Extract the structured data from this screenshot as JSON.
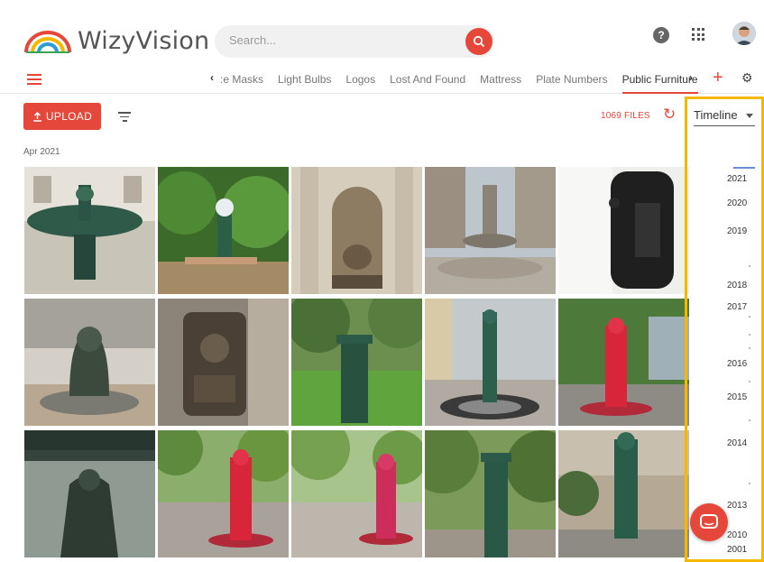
{
  "brand": {
    "name": "WizyVision",
    "accent_color": "#e5483a",
    "highlight_color": "#f5b800"
  },
  "search": {
    "placeholder": "Search...",
    "icon": "search-icon"
  },
  "header_icons": [
    "help-icon",
    "apps-grid-icon",
    "avatar"
  ],
  "tabs": {
    "prev_label": "‹",
    "items": [
      ":e Masks",
      "Light Bulbs",
      "Logos",
      "Lost And Found",
      "Mattress",
      "Plate Numbers",
      "Public Furniture"
    ],
    "active": "Public Furniture",
    "next_label": "›"
  },
  "toolbar": {
    "upload_label": "UPLOAD",
    "files_count": "1069 FILES",
    "view_select": "Timeline"
  },
  "gallery": {
    "date_label": "Apr 2021",
    "photos": [
      "Green ornate fountain",
      "Wallace fountain in garden",
      "Stone niche fountain",
      "Fountain in square",
      "Black wall fountain",
      "Bronze frog fountain",
      "Ornate wall fountain",
      "Green pillar fountain",
      "Green Wallace fountain",
      "Red Wallace fountain",
      "Wallace fountain detail",
      "Red Wallace fountain",
      "Pink Wallace fountain",
      "Green pillar fountain",
      "Green Wallace fountain"
    ]
  },
  "timeline": {
    "years": [
      "2021",
      "2020",
      "2019",
      "2018",
      "2017",
      "2016",
      "2015",
      "2014",
      "2013",
      "2010",
      "2001"
    ]
  }
}
